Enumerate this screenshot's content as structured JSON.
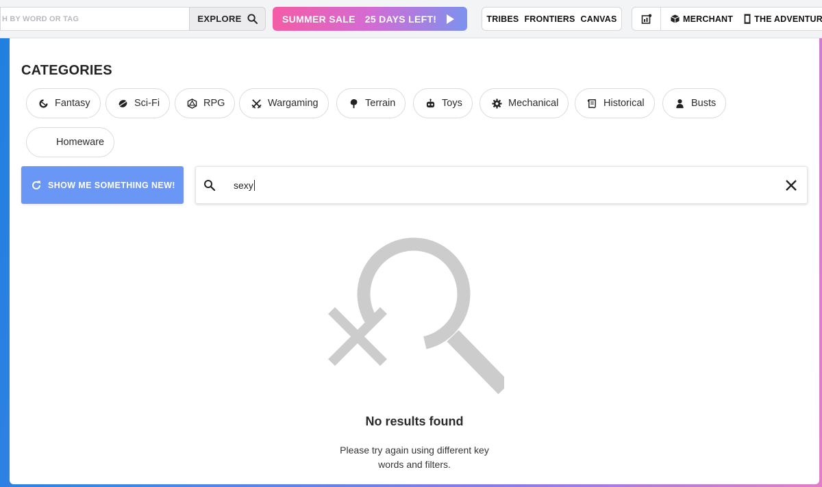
{
  "topbar": {
    "search_placeholder": "H BY WORD OR TAG",
    "explore_label": "EXPLORE",
    "sale": {
      "label": "SUMMER SALE",
      "countdown": "25 DAYS LEFT!"
    },
    "nav": [
      "TRIBES",
      "FRONTIERS",
      "CANVAS"
    ],
    "right": {
      "merchant_label": "MERCHANT",
      "adventure_label": "THE ADVENTURE"
    }
  },
  "categories": {
    "title": "CATEGORIES",
    "items": [
      {
        "label": "Fantasy",
        "icon": "fantasy-icon"
      },
      {
        "label": "Sci-Fi",
        "icon": "scifi-icon"
      },
      {
        "label": "RPG",
        "icon": "d20-icon"
      },
      {
        "label": "Wargaming",
        "icon": "crossed-swords-icon"
      },
      {
        "label": "Terrain",
        "icon": "tree-icon"
      },
      {
        "label": "Toys",
        "icon": "robot-icon"
      },
      {
        "label": "Mechanical",
        "icon": "gear-icon"
      },
      {
        "label": "Historical",
        "icon": "scroll-icon"
      },
      {
        "label": "Busts",
        "icon": "bust-icon"
      },
      {
        "label": "Homeware",
        "icon": ""
      }
    ]
  },
  "actions": {
    "show_new_label": "SHOW ME SOMETHING NEW!"
  },
  "search": {
    "value": "sexy"
  },
  "empty": {
    "title": "No results found",
    "hint": "Please try again using different key words and filters."
  },
  "colors": {
    "accent": "#6a96f5",
    "sale_start": "#f45ca5",
    "sale_end": "#7d92ee",
    "empty_icon": "#cccccc"
  }
}
